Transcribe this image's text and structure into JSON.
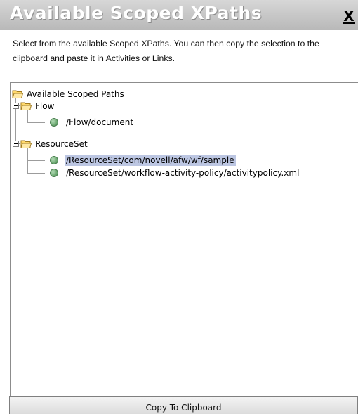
{
  "dialog": {
    "title": "Available Scoped XPaths",
    "close_label": "X",
    "description": "Select from the available Scoped XPaths.  You can then copy the selection to the clipboard and paste it in Activities or Links."
  },
  "tree": {
    "root_label": "Available Scoped Paths",
    "groups": [
      {
        "label": "Flow",
        "expanded": true,
        "items": [
          {
            "label": "/Flow/document",
            "selected": false
          }
        ]
      },
      {
        "label": "ResourceSet",
        "expanded": true,
        "items": [
          {
            "label": "/ResourceSet/com/novell/afw/wf/sample",
            "selected": true
          },
          {
            "label": "/ResourceSet/workflow-activity-policy/activitypolicy.xml",
            "selected": false
          }
        ]
      }
    ],
    "selection_color": "#bcc6e2",
    "leaf_color": "#6faa74"
  },
  "footer": {
    "copy_button_label": "Copy To Clipboard"
  }
}
